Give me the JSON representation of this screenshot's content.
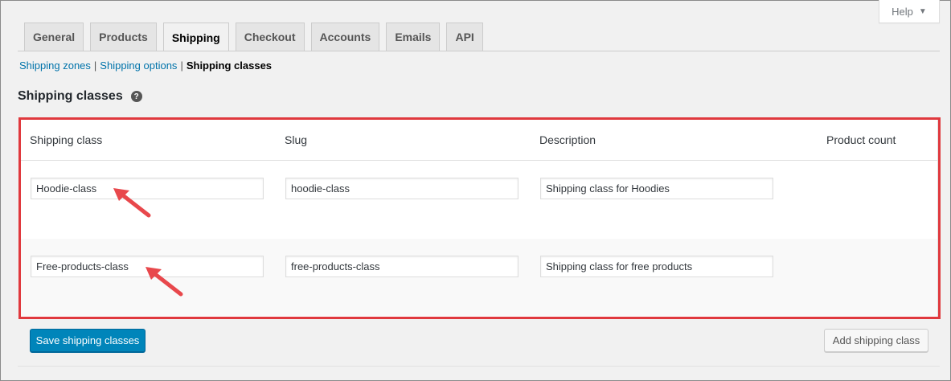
{
  "help": {
    "label": "Help",
    "caret": "▼"
  },
  "tabs": [
    {
      "label": "General",
      "active": false
    },
    {
      "label": "Products",
      "active": false
    },
    {
      "label": "Shipping",
      "active": true
    },
    {
      "label": "Checkout",
      "active": false
    },
    {
      "label": "Accounts",
      "active": false
    },
    {
      "label": "Emails",
      "active": false
    },
    {
      "label": "API",
      "active": false
    }
  ],
  "subnav": {
    "zones": "Shipping zones",
    "options": "Shipping options",
    "classes": "Shipping classes",
    "separator": "|"
  },
  "section": {
    "title": "Shipping classes",
    "help_icon": "?"
  },
  "table": {
    "headers": [
      "Shipping class",
      "Slug",
      "Description",
      "Product count"
    ],
    "rows": [
      {
        "name": "Hoodie-class",
        "slug": "hoodie-class",
        "description": "Shipping class for Hoodies",
        "count": ""
      },
      {
        "name": "Free-products-class",
        "slug": "free-products-class",
        "description": "Shipping class for free products",
        "count": ""
      }
    ]
  },
  "buttons": {
    "save": "Save shipping classes",
    "add": "Add shipping class"
  },
  "colors": {
    "accent": "#0085ba",
    "link": "#0073aa",
    "highlight": "#e0393e"
  }
}
